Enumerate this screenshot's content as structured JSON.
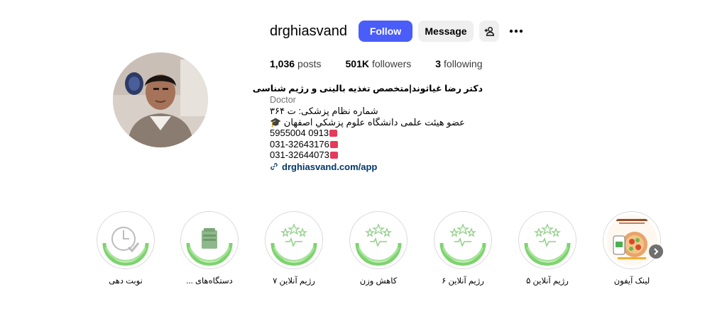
{
  "profile": {
    "username": "drghiasvand",
    "follow_label": "Follow",
    "message_label": "Message"
  },
  "stats": {
    "posts_count": "1,036",
    "posts_label": "posts",
    "followers_count": "501K",
    "followers_label": "followers",
    "following_count": "3",
    "following_label": "following"
  },
  "bio": {
    "name": "دکتر رضا غیاثوند|متخصص تغذیه بالینی و رژیم شناسی",
    "category": "Doctor",
    "line1": "شماره نظام پزشکی: ت ۳۶۴",
    "line2": "عضو هیئت علمی دانشگاه علوم پزشکي اصفهان 🎓",
    "line3": "5955004 0913",
    "line4": "031-32643176",
    "line5": "031-32644073",
    "link": "drghiasvand.com/app"
  },
  "highlights": [
    {
      "label": "نوبت دهی",
      "icon": "clock-check-icon"
    },
    {
      "label": "دستگاه‌های ...",
      "icon": "device-icon"
    },
    {
      "label": "رژیم آنلاین ۷",
      "icon": "stars-icon"
    },
    {
      "label": "کاهش وزن",
      "icon": "stars-icon"
    },
    {
      "label": "رژیم آنلاین ۶",
      "icon": "stars-icon"
    },
    {
      "label": "رژیم آنلاین ۵",
      "icon": "stars-icon"
    },
    {
      "label": "لینک آیفون",
      "icon": "app-promo-image"
    }
  ],
  "colors": {
    "follow_bg": "#4a5df9",
    "ring_green": "#6ecb63",
    "link": "#00376b"
  }
}
